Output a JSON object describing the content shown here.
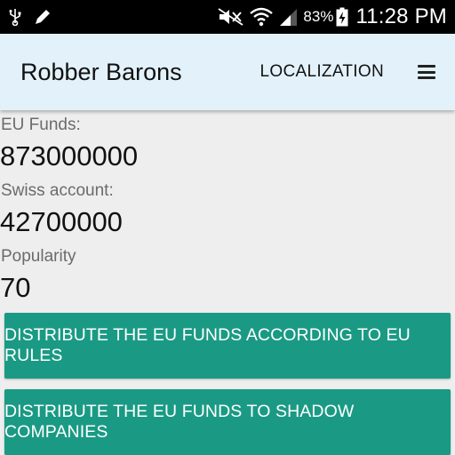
{
  "status_bar": {
    "icons": [
      "usb-icon",
      "pencil-icon",
      "mute-icon",
      "wifi-icon",
      "signal-icon",
      "battery-charging-icon"
    ],
    "battery": "83%",
    "time": "11:28 PM"
  },
  "app_bar": {
    "title": "Robber Barons",
    "action": "LOCALIZATION",
    "overflow_icon": "overflow-menu-icon"
  },
  "stats": {
    "eu_funds": {
      "label": "EU Funds:",
      "value": "873000000"
    },
    "swiss_account": {
      "label": "Swiss account:",
      "value": "42700000"
    },
    "popularity": {
      "label": "Popularity",
      "value": "70"
    }
  },
  "actions": {
    "by_rules": "DISTRIBUTE THE EU FUNDS ACCORDING TO EU RULES",
    "shadow": "DISTRIBUTE THE EU FUNDS TO SHADOW COMPANIES"
  },
  "colors": {
    "app_bar_bg": "#e3f2fa",
    "button_bg": "#1a9a84",
    "page_bg": "#eeeeee"
  }
}
